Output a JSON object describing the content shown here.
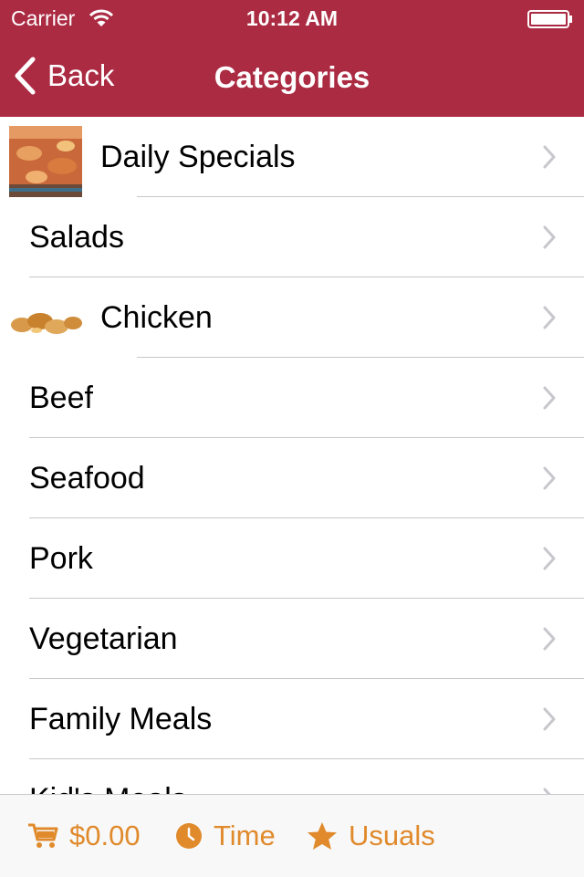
{
  "status_bar": {
    "carrier": "Carrier",
    "time": "10:12 AM"
  },
  "nav": {
    "back_label": "Back",
    "title": "Categories"
  },
  "categories": [
    {
      "label": "Daily Specials",
      "image": "lasagna-photo"
    },
    {
      "label": "Salads"
    },
    {
      "label": "Chicken",
      "image": "fried-chicken-photo"
    },
    {
      "label": "Beef"
    },
    {
      "label": "Seafood"
    },
    {
      "label": "Pork"
    },
    {
      "label": "Vegetarian"
    },
    {
      "label": "Family Meals"
    },
    {
      "label": "Kid's Meals"
    }
  ],
  "tab_bar": {
    "cart_total": "$0.00",
    "time_label": "Time",
    "usuals_label": "Usuals"
  },
  "colors": {
    "nav_background": "#ab2b43",
    "accent": "#e08a2c"
  }
}
